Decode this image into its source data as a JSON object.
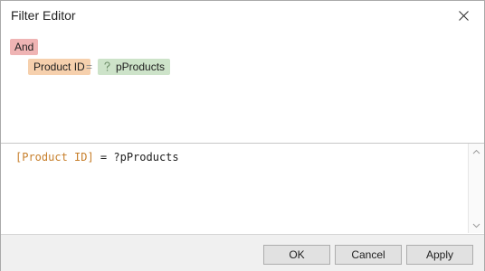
{
  "window": {
    "title": "Filter Editor"
  },
  "tree": {
    "group_operator": "And",
    "condition": {
      "field": "Product ID",
      "operator": "=",
      "parameter": "pProducts",
      "parameter_icon": "question-mark-icon"
    }
  },
  "expression": {
    "field": "[Product ID]",
    "rest": " = ?pProducts"
  },
  "buttons": {
    "ok": "OK",
    "cancel": "Cancel",
    "apply": "Apply"
  },
  "colors": {
    "group_bg": "#efb4b4",
    "field_bg": "#f6d0ad",
    "param_bg": "#cde3c9",
    "field_text": "#c77f2b"
  }
}
